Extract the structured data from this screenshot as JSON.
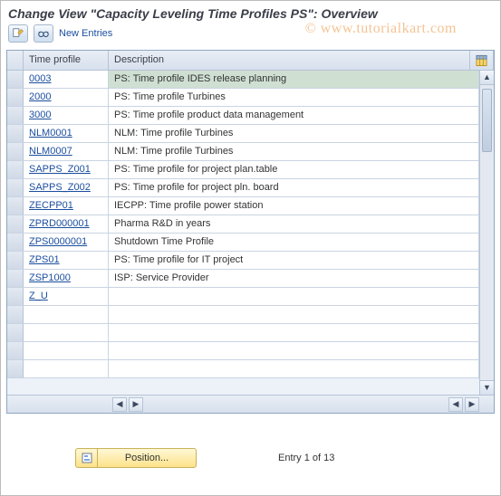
{
  "title": "Change View \"Capacity Leveling Time Profiles PS\": Overview",
  "watermark": "© www.tutorialkart.com",
  "toolbar": {
    "new_entries_label": "New Entries",
    "icon1_name": "other-view-icon",
    "icon2_name": "glasses-icon"
  },
  "table": {
    "columns": {
      "time_profile": "Time profile",
      "description": "Description"
    },
    "config_icon": "configure-columns-icon",
    "selected_index": 0,
    "rows": [
      {
        "tp": "0003",
        "desc": "PS: Time profile IDES release planning"
      },
      {
        "tp": "2000",
        "desc": "PS: Time profile Turbines"
      },
      {
        "tp": "3000",
        "desc": "PS: Time profile product data management"
      },
      {
        "tp": "NLM0001",
        "desc": "NLM: Time profile Turbines"
      },
      {
        "tp": "NLM0007",
        "desc": "NLM: Time profile Turbines"
      },
      {
        "tp": "SAPPS_Z001",
        "desc": "PS: Time profile for project plan.table"
      },
      {
        "tp": "SAPPS_Z002",
        "desc": "PS: Time profile for project pln. board"
      },
      {
        "tp": "ZECPP01",
        "desc": "IECPP: Time profile power station"
      },
      {
        "tp": "ZPRD000001",
        "desc": "Pharma R&D in years"
      },
      {
        "tp": "ZPS0000001",
        "desc": "Shutdown Time Profile"
      },
      {
        "tp": "ZPS01",
        "desc": "PS: Time profile for IT project"
      },
      {
        "tp": "ZSP1000",
        "desc": "ISP: Service Provider"
      },
      {
        "tp": "Z_U",
        "desc": ""
      }
    ],
    "blank_rows": 4
  },
  "footer": {
    "position_label": "Position...",
    "entry_text": "Entry 1 of 13"
  },
  "colors": {
    "link": "#1a4e9e",
    "selection_bg": "#cfe0d3",
    "button_bg": "#fce28a"
  }
}
